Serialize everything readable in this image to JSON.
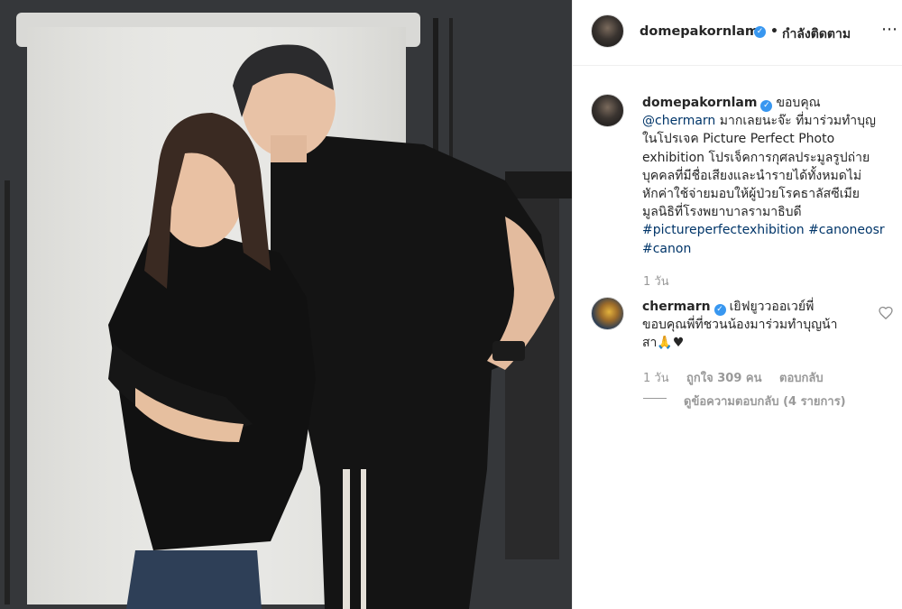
{
  "post": {
    "author": "domepakornlam",
    "follow_separator": "•",
    "follow_label": "กำลังติดตาม",
    "more_icon": "more-options-icon"
  },
  "caption": {
    "username": "domepakornlam",
    "lines": [
      "ขอบคุณ",
      "มากเลยนะจ๊ะ ที่มาร่วมทำบุญ",
      "ในโปรเจค Picture Perfect Photo",
      "exhibition โปรเจ็คการกุศลประมูลรูปถ่าย",
      "บุคคลที่มีชื่อเสียงและนำรายได้ทั้งหมดไม่",
      "หักค่าใช้จ่ายมอบให้ผู้ป่วยโรคธาลัสซีเมีย",
      "มูลนิธิที่โรงพยาบาลรามาธิบดี"
    ],
    "mention": "@chermarn",
    "hashtags_line1": "#pictureperfectexhibition #canoneosr",
    "hashtags_line2": "#canon",
    "time": "1 วัน"
  },
  "comment": {
    "username": "chermarn",
    "lines": [
      "เยิฟยูววออเวย์พี่",
      "ขอบคุณพี่ที่ชวนน้องมาร่วมทำบุญน้า",
      "สา🙏♥"
    ],
    "time": "1 วัน",
    "likes": "ถูกใจ 309 คน",
    "reply": "ตอบกลับ",
    "view_replies": "ดูข้อความตอบกลับ (4 รายการ)"
  },
  "colors": {
    "link": "#003569",
    "verified": "#3897f0",
    "meta": "#999999",
    "border": "#efefef"
  }
}
